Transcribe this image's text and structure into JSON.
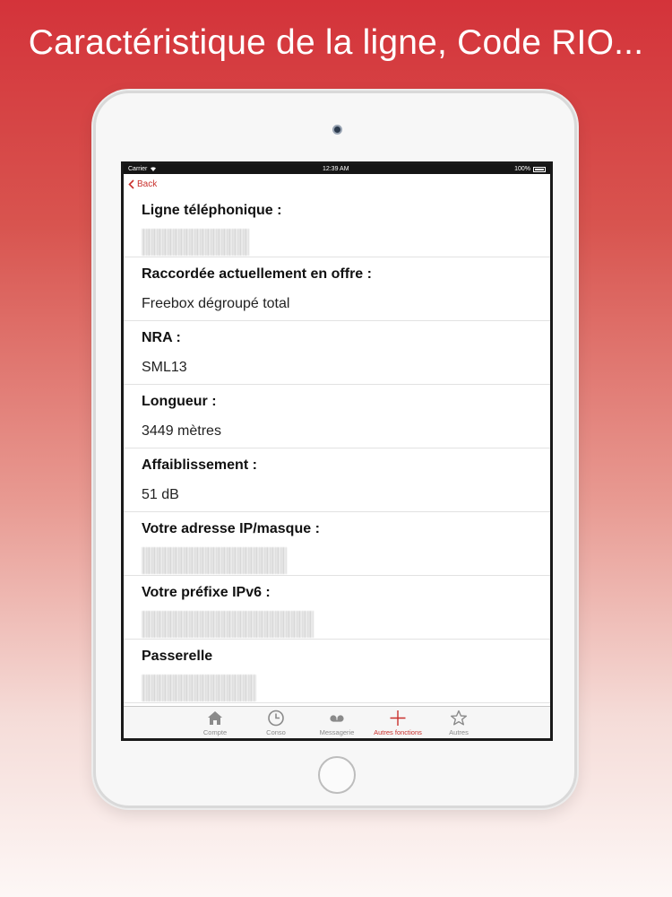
{
  "headline": "Caractéristique de la ligne, Code RIO...",
  "status_bar": {
    "carrier": "Carrier",
    "time": "12:39 AM",
    "battery": "100%"
  },
  "nav": {
    "back_label": "Back"
  },
  "rows": [
    {
      "label": "Ligne téléphonique :",
      "value": ""
    },
    {
      "label": "Raccordée actuellement en offre  :",
      "value": "Freebox dégroupé total"
    },
    {
      "label": "NRA :",
      "value": "SML13"
    },
    {
      "label": "Longueur :",
      "value": "3449 mètres"
    },
    {
      "label": "Affaiblissement :",
      "value": "51 dB"
    },
    {
      "label": "Votre adresse IP/masque :",
      "value": ""
    },
    {
      "label": "Votre préfixe IPv6 :",
      "value": ""
    },
    {
      "label": "Passerelle",
      "value": ""
    }
  ],
  "tabs": [
    {
      "label": "Compte",
      "icon": "home-icon",
      "active": false
    },
    {
      "label": "Conso",
      "icon": "clock-icon",
      "active": false
    },
    {
      "label": "Messagerie",
      "icon": "voicemail-icon",
      "active": false
    },
    {
      "label": "Autres fonctions",
      "icon": "plus-icon",
      "active": true
    },
    {
      "label": "Autres",
      "icon": "star-icon",
      "active": false
    }
  ],
  "colors": {
    "accent": "#c9302c",
    "background_top": "#d4333a"
  }
}
